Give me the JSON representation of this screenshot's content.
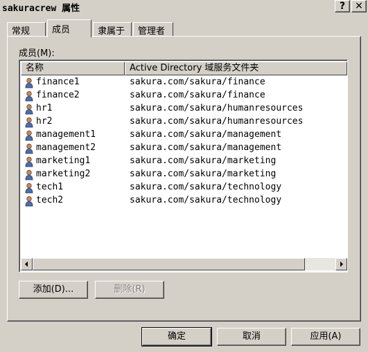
{
  "window": {
    "title": "sakuracrew 属性",
    "help_label": "?",
    "close_label": "✕"
  },
  "tabs": [
    {
      "label": "常规"
    },
    {
      "label": "成员"
    },
    {
      "label": "隶属于"
    },
    {
      "label": "管理者"
    }
  ],
  "members": {
    "label": "成员(M):",
    "columns": [
      "名称",
      "Active Directory 域服务文件夹"
    ],
    "rows": [
      {
        "name": "finance1",
        "path": "sakura.com/sakura/finance"
      },
      {
        "name": "finance2",
        "path": "sakura.com/sakura/finance"
      },
      {
        "name": "hr1",
        "path": "sakura.com/sakura/humanresources"
      },
      {
        "name": "hr2",
        "path": "sakura.com/sakura/humanresources"
      },
      {
        "name": "management1",
        "path": "sakura.com/sakura/management"
      },
      {
        "name": "management2",
        "path": "sakura.com/sakura/management"
      },
      {
        "name": "marketing1",
        "path": "sakura.com/sakura/marketing"
      },
      {
        "name": "marketing2",
        "path": "sakura.com/sakura/marketing"
      },
      {
        "name": "tech1",
        "path": "sakura.com/sakura/technology"
      },
      {
        "name": "tech2",
        "path": "sakura.com/sakura/technology"
      }
    ],
    "row_icon": "user-icon"
  },
  "actions": {
    "add_label": "添加(D)...",
    "remove_label": "删除(R)"
  },
  "footer": {
    "ok_label": "确定",
    "cancel_label": "取消",
    "apply_label": "应用(A)"
  }
}
